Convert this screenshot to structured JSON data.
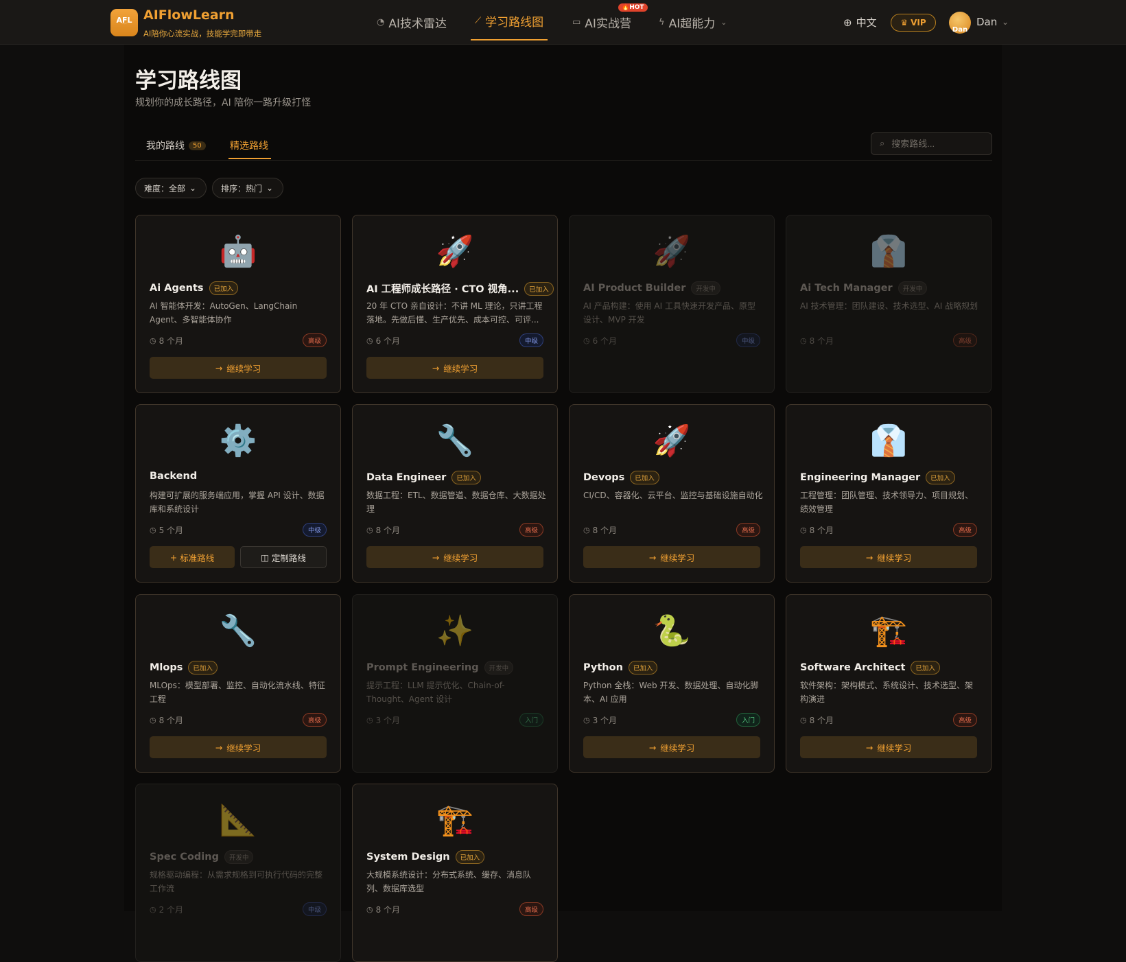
{
  "header": {
    "logo_text": "AFL",
    "brand": "AIFlowLearn",
    "tagline": "AI陪你心流实战，技能学完即带走",
    "nav": [
      {
        "label": "AI技术雷达",
        "icon": "radar-icon"
      },
      {
        "label": "学习路线图",
        "icon": "trend-icon",
        "active": true
      },
      {
        "label": "AI实战营",
        "icon": "terminal-icon",
        "badge": "🔥HOT"
      },
      {
        "label": "AI超能力",
        "icon": "bolt-icon",
        "dropdown": true
      }
    ],
    "language": "中文",
    "vip": "VIP",
    "avatar_text": "Dan",
    "username": "Dan"
  },
  "page": {
    "title": "学习路线图",
    "subtitle": "规划你的成长路径，AI 陪你一路升级打怪"
  },
  "tabs": [
    {
      "label": "我的路线",
      "count": "50"
    },
    {
      "label": "精选路线",
      "active": true
    }
  ],
  "search": {
    "placeholder": "搜索路线..."
  },
  "filters": [
    {
      "label": "难度：全部"
    },
    {
      "label": "排序：热门"
    }
  ],
  "colors": {
    "accent": "#f0a032",
    "background": "#0f0e0d",
    "card": "#161412"
  },
  "cards": [
    {
      "emoji": "🤖",
      "name": "Ai Agents",
      "status": "已加入",
      "desc": "AI 智能体开发：AutoGen、LangChain Agent、多智能体协作",
      "duration": "8 个月",
      "level": "高级",
      "action": "继续学习"
    },
    {
      "emoji": "🚀",
      "name": "AI 工程师成长路径 · CTO 视角...",
      "status": "已加入",
      "desc": "20 年 CTO 亲自设计：不讲 ML 理论，只讲工程落地。先做后懂、生产优先、成本可控、可评...",
      "duration": "6 个月",
      "level": "中级",
      "action": "继续学习"
    },
    {
      "emoji": "🚀",
      "name": "AI Product Builder",
      "status": "开发中",
      "desc": "AI 产品构建：使用 AI 工具快速开发产品、原型设计、MVP 开发",
      "duration": "6 个月",
      "level": "中级"
    },
    {
      "emoji": "👔",
      "name": "Ai Tech Manager",
      "status": "开发中",
      "desc": "AI 技术管理：团队建设、技术选型、AI 战略规划",
      "duration": "8 个月",
      "level": "高级"
    },
    {
      "emoji": "⚙️",
      "name": "Backend",
      "desc": "构建可扩展的服务端应用，掌握 API 设计、数据库和系统设计",
      "duration": "5 个月",
      "level": "中级",
      "action_std": "标准路线",
      "action_custom": "定制路线"
    },
    {
      "emoji": "🔧",
      "name": "Data Engineer",
      "status": "已加入",
      "desc": "数据工程：ETL、数据管道、数据仓库、大数据处理",
      "duration": "8 个月",
      "level": "高级",
      "action": "继续学习"
    },
    {
      "emoji": "🚀",
      "name": "Devops",
      "status": "已加入",
      "desc": "CI/CD、容器化、云平台、监控与基础设施自动化",
      "duration": "8 个月",
      "level": "高级",
      "action": "继续学习"
    },
    {
      "emoji": "👔",
      "name": "Engineering Manager",
      "status": "已加入",
      "desc": "工程管理：团队管理、技术领导力、项目规划、绩效管理",
      "duration": "8 个月",
      "level": "高级",
      "action": "继续学习"
    },
    {
      "emoji": "🔧",
      "name": "Mlops",
      "status": "已加入",
      "desc": "MLOps：模型部署、监控、自动化流水线、特征工程",
      "duration": "8 个月",
      "level": "高级",
      "action": "继续学习"
    },
    {
      "emoji": "✨",
      "name": "Prompt Engineering",
      "status": "开发中",
      "desc": "提示工程：LLM 提示优化、Chain-of-Thought、Agent 设计",
      "duration": "3 个月",
      "level": "入门"
    },
    {
      "emoji": "🐍",
      "name": "Python",
      "status": "已加入",
      "desc": "Python 全栈：Web 开发、数据处理、自动化脚本、AI 应用",
      "duration": "3 个月",
      "level": "入门",
      "action": "继续学习"
    },
    {
      "emoji": "🏗️",
      "name": "Software Architect",
      "status": "已加入",
      "desc": "软件架构：架构模式、系统设计、技术选型、架构演进",
      "duration": "8 个月",
      "level": "高级",
      "action": "继续学习"
    },
    {
      "emoji": "📐",
      "name": "Spec Coding",
      "status": "开发中",
      "desc": "规格驱动编程：从需求规格到可执行代码的完整工作流",
      "duration": "2 个月",
      "level": "中级"
    },
    {
      "emoji": "🏗️",
      "name": "System Design",
      "status": "已加入",
      "desc": "大规模系统设计：分布式系统、缓存、消息队列、数据库选型",
      "duration": "8 个月",
      "level": "高级"
    }
  ]
}
